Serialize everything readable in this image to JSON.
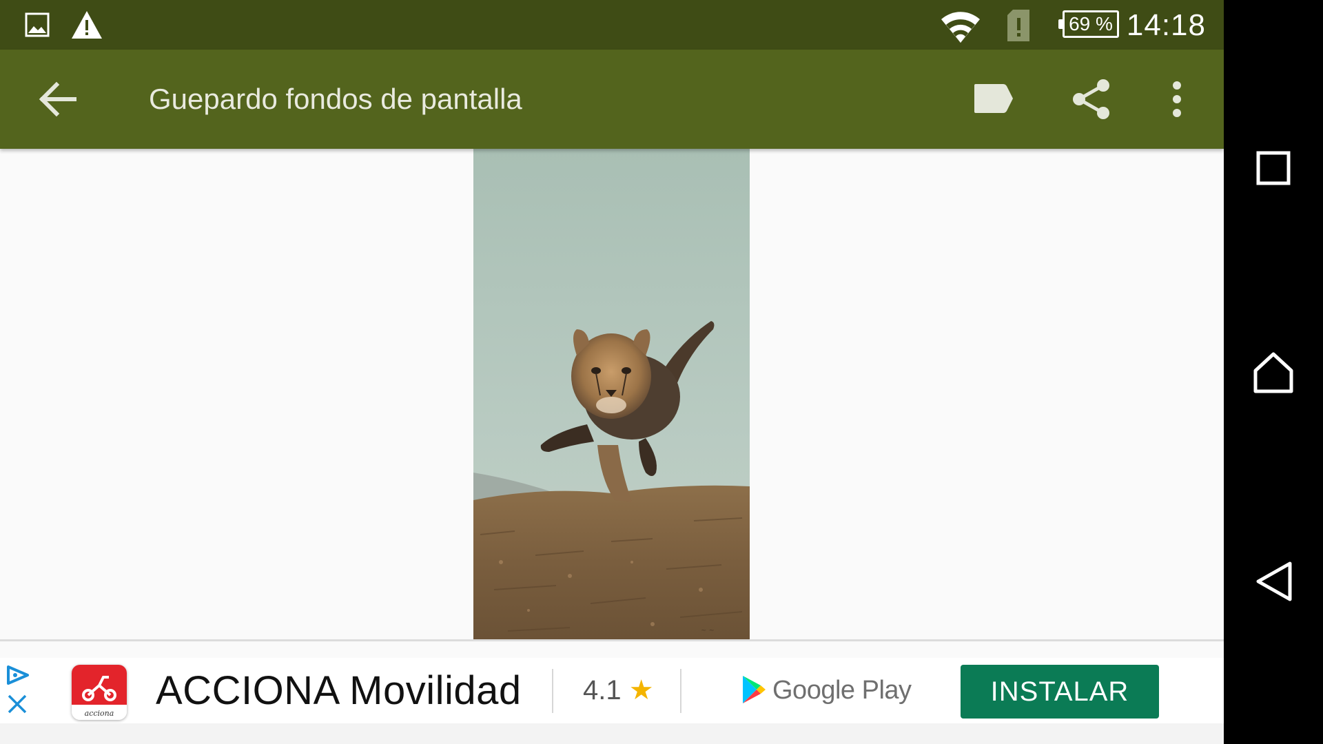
{
  "status_bar": {
    "time": "14:18",
    "battery_percent": "69 %",
    "icons": [
      "image-notification-icon",
      "warning-icon",
      "wifi-icon",
      "sim-alert-icon",
      "battery-icon"
    ]
  },
  "app_bar": {
    "title": "Guepardo fondos de pantalla",
    "icons": [
      "back-arrow-icon",
      "label-icon",
      "share-icon",
      "more-vert-icon"
    ]
  },
  "content": {
    "image_subject": "cheetah cub running"
  },
  "ad": {
    "app_name": "ACCIONA Movilidad",
    "rating": "4.1",
    "store": "Google Play",
    "install_label": "INSTALAR",
    "icon_text": "acciona",
    "colors": {
      "install_button": "#0b7b55",
      "ad_choices": "#1a8fd8"
    }
  },
  "nav_bar": {
    "icons": [
      "recents-icon",
      "home-icon",
      "back-icon"
    ]
  },
  "colors": {
    "status_bar": "#3f4c15",
    "app_bar": "#53641d",
    "background": "#fafafa"
  }
}
